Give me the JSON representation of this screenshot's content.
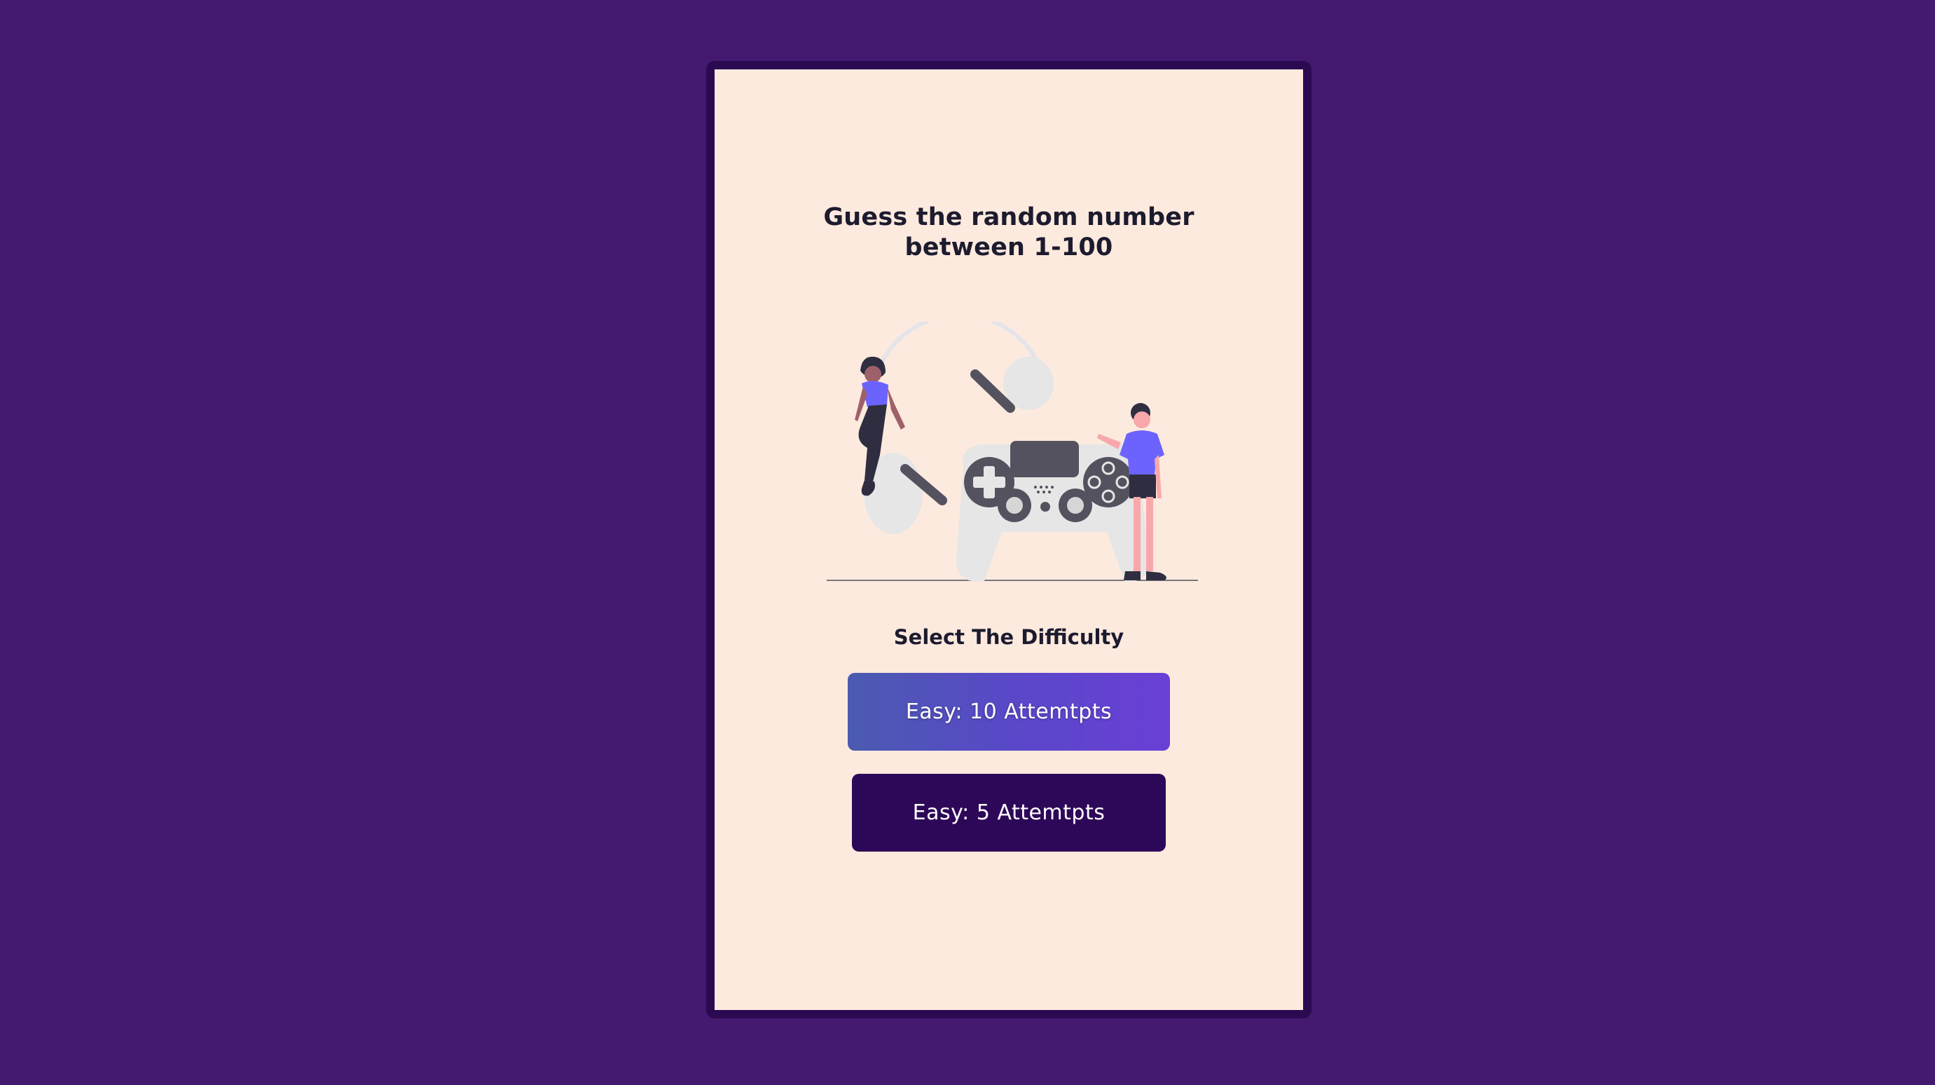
{
  "page": {
    "title_line1": "Guess the random number",
    "title_line2": "between 1-100",
    "difficulty_heading": "Select The Difficulty"
  },
  "buttons": {
    "easy_label": "Easy: 10 Attemtpts",
    "hard_label": "Easy: 5 Attemtpts"
  },
  "colors": {
    "background": "#441970",
    "card": "#fdeade",
    "frame": "#2b0a52",
    "accent_gradient_start": "#4b5bb0",
    "accent_gradient_end": "#6a3fd6",
    "dark_button": "#2e0858",
    "illustration_purple": "#6c63ff"
  },
  "illustration": {
    "icon": "gamepad-illustration"
  }
}
